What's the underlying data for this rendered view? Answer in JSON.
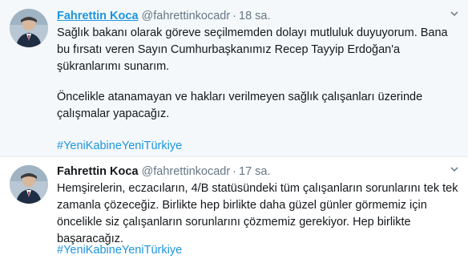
{
  "tweets": [
    {
      "display_name": "Fahrettin Koca",
      "handle": "@fahrettinkocadr",
      "separator": "·",
      "time": "18 sa.",
      "paragraphs": [
        "Sağlık bakanı olarak göreve seçilmemden dolayı mutluluk duyuyorum. Bana bu fırsatı veren Sayın Cumhurbaşkanımız Recep Tayyip Erdoğan'a şükranlarımı sunarım.",
        "Öncelikle atanamayan ve hakları verilmeyen sağlık çalışanları üzerinde çalışmalar yapacağız."
      ],
      "hashtag": "#YeniKabineYeniTürkiye"
    },
    {
      "display_name": "Fahrettin Koca",
      "handle": "@fahrettinkocadr",
      "separator": "·",
      "time": "17 sa.",
      "paragraphs": [
        "Hemşirelerin, eczacıların, 4/B statüsündeki tüm çalışanların sorunlarını tek tek zamanla çözeceğiz. Birlikte hep birlikte daha güzel günler görmemiz için öncelikle siz çalışanların sorunlarını çözmemiz gerekiyor. Hep birlikte başaracağız."
      ],
      "hashtag": "#YeniKabineYeniTürkiye"
    }
  ],
  "icons": {
    "avatar": "profile-photo",
    "menu": "chevron-down-icon"
  },
  "colors": {
    "link": "#1b95e0",
    "muted": "#657786",
    "text": "#14171a",
    "highlight_bg": "#f5f8fa"
  }
}
